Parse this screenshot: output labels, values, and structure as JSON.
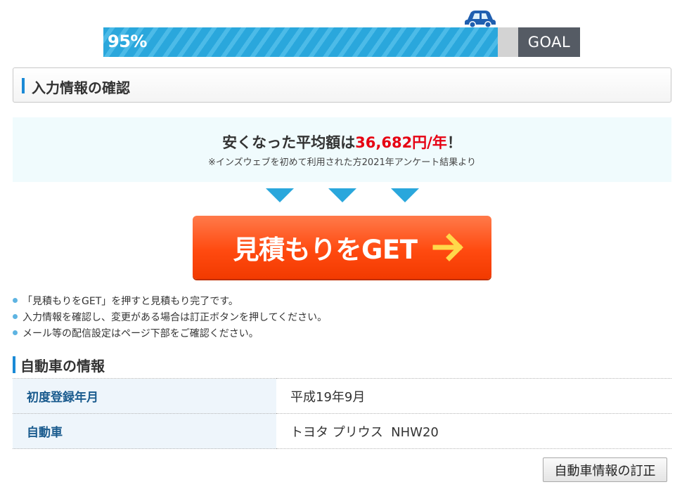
{
  "progress": {
    "percent_label": "95%",
    "value": 0.95,
    "goal_label": "GOAL",
    "car_icon": "car-icon",
    "color": "#2aa7dc"
  },
  "section": {
    "title": "入力情報の確認"
  },
  "savings": {
    "headline_prefix": "安くなった平均額は",
    "amount": "36,682円/年",
    "headline_suffix": "！",
    "note": "※インズウェブを初めて利用された方2021年アンケート結果より",
    "amount_color": "#e60012"
  },
  "cta": {
    "label": "見積もりをGET",
    "arrow_icon": "arrow-right-icon"
  },
  "notes": [
    "「見積もりをGET」を押すと見積もり完了です。",
    "入力情報を確認し、変更がある場合は訂正ボタンを押してください。",
    "メール等の配信設定はページ下部をご確認ください。"
  ],
  "car_info": {
    "title": "自動車の情報",
    "rows": [
      {
        "label": "初度登録年月",
        "value": "平成19年9月"
      },
      {
        "label": "自動車",
        "value": "トヨタ プリウス  NHW20"
      }
    ],
    "edit_button": "自動車情報の訂正"
  }
}
